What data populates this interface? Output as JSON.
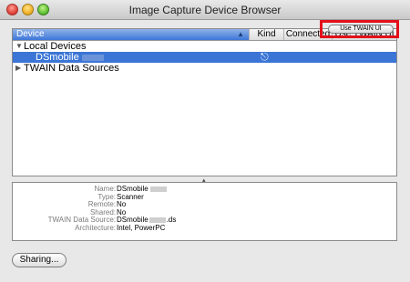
{
  "window": {
    "title": "Image Capture Device Browser"
  },
  "table": {
    "columns": [
      "Device",
      "Kind",
      "Connected",
      "Use TWAIN UI"
    ],
    "groups": {
      "local": "Local Devices",
      "twain": "TWAIN Data Sources"
    },
    "device_row": {
      "name": "DSmobile",
      "kind_icon": "usb-icon",
      "twain_button": "Use TWAIN UI"
    }
  },
  "info": [
    {
      "key": "Name:",
      "value": "DSmobile",
      "redacted_suffix": true
    },
    {
      "key": "Type:",
      "value": "Scanner"
    },
    {
      "key": "Remote:",
      "value": "No"
    },
    {
      "key": "Shared:",
      "value": "No"
    },
    {
      "key": "TWAIN Data Source:",
      "value_prefix": "DSmobile",
      "value_suffix": ".ds"
    },
    {
      "key": "Architecture:",
      "value": "Intel, PowerPC"
    }
  ],
  "footer": {
    "sharing_button": "Sharing..."
  },
  "colors": {
    "selection": "#3b75d6",
    "highlight_box": "#e3101a"
  }
}
